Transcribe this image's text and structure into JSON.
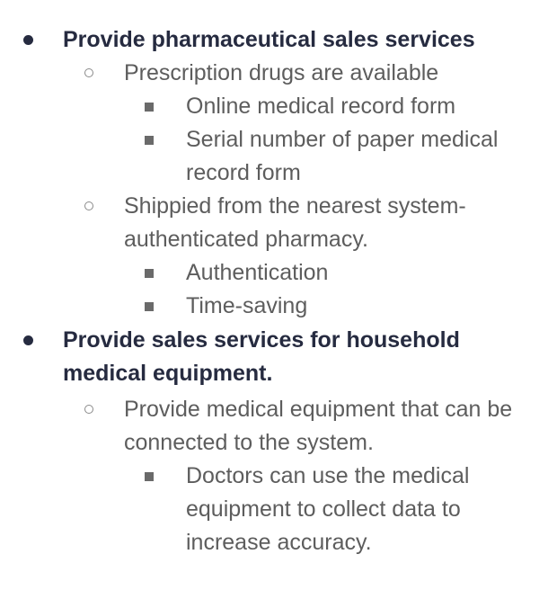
{
  "outline": {
    "items": [
      {
        "text": "Provide pharmaceutical sales services",
        "children": [
          {
            "text": "Prescription drugs are available",
            "children": [
              {
                "text": "Online medical record form"
              },
              {
                "text": "Serial number of paper medical record form"
              }
            ]
          },
          {
            "text": "Shippied from the nearest system-authenticated pharmacy.",
            "children": [
              {
                "text": "Authentication"
              },
              {
                "text": "Time-saving"
              }
            ]
          }
        ]
      },
      {
        "text": "Provide sales services for household medical equipment.",
        "children": [
          {
            "text": "Provide medical equipment that can be connected to the system.",
            "children": [
              {
                "text": "Doctors can use the medical equipment to collect data to increase accuracy."
              }
            ]
          }
        ]
      }
    ]
  },
  "colors": {
    "level1_text": "#262b40",
    "sublevel_text": "#5d5d5d",
    "background": "#ffffff"
  }
}
